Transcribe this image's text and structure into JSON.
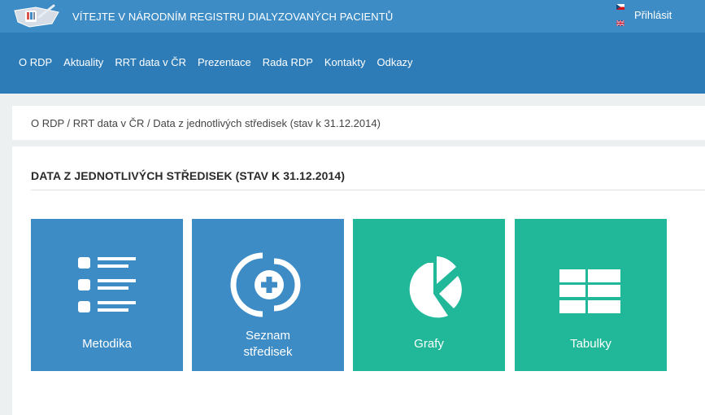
{
  "header": {
    "site_title": "VÍTEJTE V NÁRODNÍM REGISTRU DIALYZOVANÝCH PACIENTŮ",
    "login_label": "Přihlásit"
  },
  "nav": {
    "items": [
      "O RDP",
      "Aktuality",
      "RRT data v ČR",
      "Prezentace",
      "Rada RDP",
      "Kontakty",
      "Odkazy"
    ]
  },
  "breadcrumb": {
    "text": "O RDP / RRT data v ČR / Data z jednotlivých středisek (stav k 31.12.2014)"
  },
  "page": {
    "title": "DATA Z JEDNOTLIVÝCH STŘEDISEK (STAV K 31.12.2014)"
  },
  "tiles": [
    {
      "label": "Metodika",
      "icon": "list-icon",
      "color": "#3d8cc6"
    },
    {
      "label_line1": "Seznam",
      "label_line2": "středisek",
      "icon": "medical-cross-icon",
      "color": "#3d8cc6"
    },
    {
      "label": "Grafy",
      "icon": "pie-chart-icon",
      "color": "#21b899"
    },
    {
      "label": "Tabulky",
      "icon": "table-icon",
      "color": "#21b899"
    }
  ],
  "colors": {
    "header": "#3d8cc6",
    "navbar": "#2d7cb7",
    "background": "#ecf0f1",
    "tile_blue": "#3d8cc6",
    "tile_green": "#21b899"
  }
}
